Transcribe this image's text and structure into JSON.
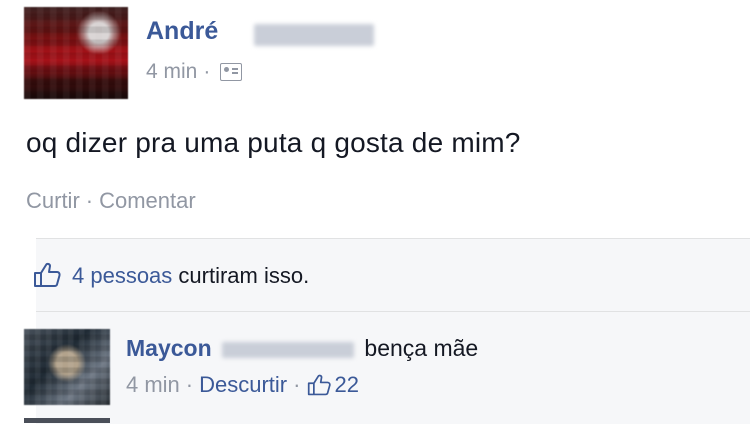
{
  "post": {
    "author": "André",
    "time": "4 min",
    "separator": "·",
    "audience_icon": "friends-icon",
    "text": "oq dizer pra uma puta q gosta de mim?",
    "actions": {
      "like": "Curtir",
      "separator": "·",
      "comment": "Comentar"
    }
  },
  "likes": {
    "icon": "thumbs-up-icon",
    "count_text": "4 pessoas",
    "suffix": "curtiram isso."
  },
  "comment": {
    "author": "Maycon",
    "text": "bença mãe",
    "time": "4 min",
    "separator": "·",
    "unlike": "Descurtir",
    "separator2": "·",
    "like_icon": "thumbs-up-icon",
    "like_count": "22"
  },
  "colors": {
    "link_blue": "#3b5998",
    "meta_grey": "#9197a3",
    "ufi_bg": "#f6f7f9"
  }
}
